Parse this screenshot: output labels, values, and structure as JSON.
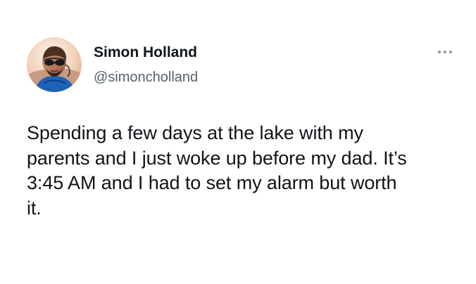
{
  "author": {
    "display_name": "Simon Holland",
    "handle": "@simoncholland",
    "avatar_icon": "profile-photo"
  },
  "menu": {
    "icon": "more-horizontal-icon"
  },
  "tweet": {
    "text": "Spending a few days at the lake with my\nparents and I just woke up before my dad. It’s\n3:45 AM and I had to set my alarm but worth\nit."
  },
  "colors": {
    "text": "#0f1419",
    "secondary_text": "#536471",
    "icon": "#8b98a5",
    "background": "#ffffff"
  }
}
